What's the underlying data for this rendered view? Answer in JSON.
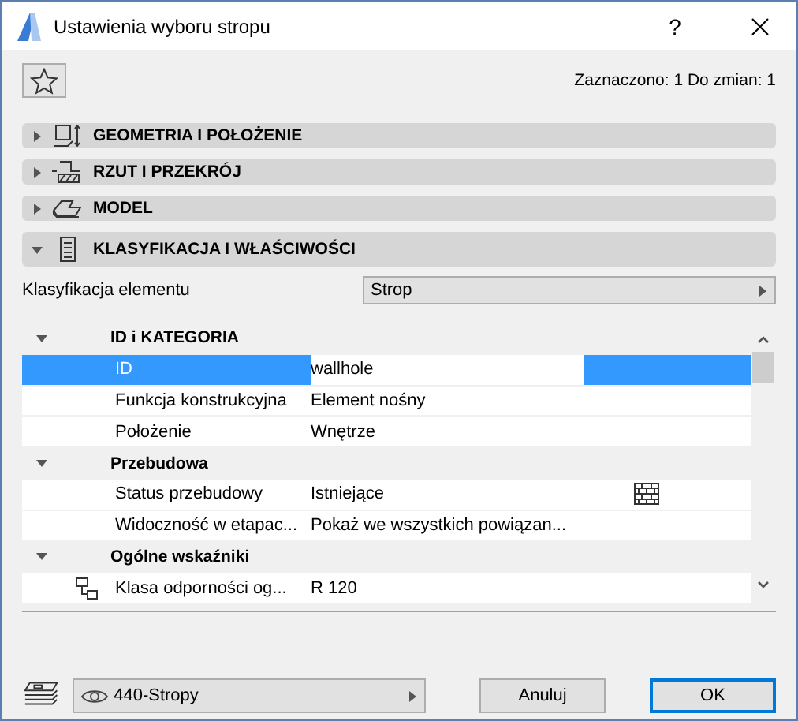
{
  "window": {
    "title": "Ustawienia wyboru stropu",
    "help": "?"
  },
  "selection_info": "Zaznaczono: 1 Do zmian: 1",
  "sections": [
    {
      "kind": "geometry",
      "label": "GEOMETRIA I POŁOŻENIE",
      "expanded": false
    },
    {
      "kind": "plan",
      "label": "RZUT I PRZEKRÓJ",
      "expanded": false
    },
    {
      "kind": "model",
      "label": "MODEL",
      "expanded": false
    },
    {
      "kind": "classification",
      "label": "KLASYFIKACJA I WŁAŚCIWOŚCI",
      "expanded": true
    }
  ],
  "classification": {
    "label": "Klasyfikacja elementu",
    "value": "Strop"
  },
  "groups": [
    {
      "title": "ID i KATEGORIA",
      "expanded": true,
      "children": [
        {
          "kind": "plain",
          "label": "ID",
          "value": "wallhole",
          "selected": true
        },
        {
          "kind": "plain",
          "label": "Funkcja konstrukcyjna",
          "value": "Element nośny",
          "selected": false
        },
        {
          "kind": "plain",
          "label": "Położenie",
          "value": "Wnętrze",
          "selected": false
        }
      ]
    },
    {
      "title": "Przebudowa",
      "expanded": true,
      "children": [
        {
          "kind": "status",
          "label": "Status przebudowy",
          "value": "Istniejące",
          "selected": false
        },
        {
          "kind": "plain",
          "label": "Widoczność w etapac...",
          "value": "Pokaż we wszystkich powiązan...",
          "selected": false
        }
      ]
    },
    {
      "title": "Ogólne wskaźniki",
      "expanded": true,
      "children": [
        {
          "kind": "linked",
          "label": "Klasa odporności og...",
          "value": "R 120",
          "selected": false
        }
      ]
    }
  ],
  "layer": {
    "value": "440-Stropy"
  },
  "buttons": [
    {
      "label": "Anuluj",
      "default": false
    },
    {
      "label": "OK",
      "default": true
    }
  ]
}
